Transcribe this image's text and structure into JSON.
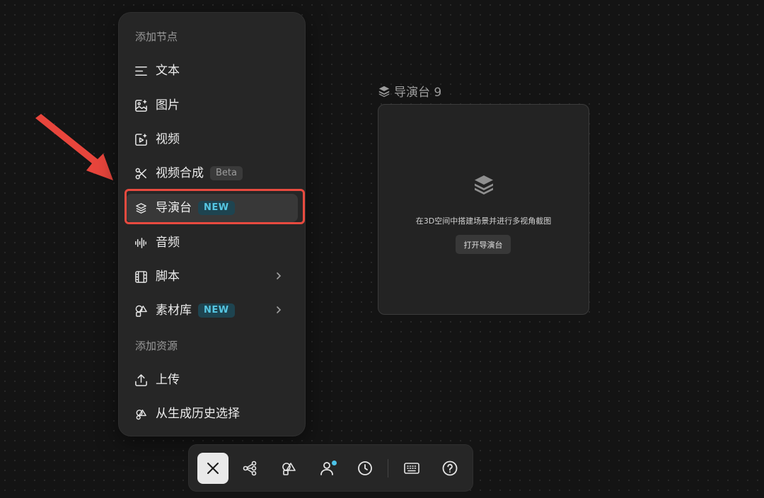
{
  "menu": {
    "add_node_title": "添加节点",
    "items": [
      {
        "label": "文本",
        "icon": "text-lines-icon"
      },
      {
        "label": "图片",
        "icon": "image-sparkle-icon"
      },
      {
        "label": "视频",
        "icon": "video-sparkle-icon"
      },
      {
        "label": "视频合成",
        "icon": "scissors-icon",
        "badge": "Beta"
      },
      {
        "label": "导演台",
        "icon": "layers-icon",
        "badge": "NEW",
        "highlighted": true
      },
      {
        "label": "音频",
        "icon": "audio-wave-icon"
      },
      {
        "label": "脚本",
        "icon": "film-script-icon",
        "has_submenu": true
      },
      {
        "label": "素材库",
        "icon": "shapes-icon",
        "badge": "NEW",
        "has_submenu": true
      }
    ],
    "add_resource_title": "添加资源",
    "resources": [
      {
        "label": "上传",
        "icon": "upload-icon"
      },
      {
        "label": "从生成历史选择",
        "icon": "history-shapes-icon"
      }
    ]
  },
  "node": {
    "title": "导演台 9",
    "description": "在3D空间中搭建场景并进行多视角截图",
    "open_button": "打开导演台"
  },
  "toolbar": {
    "buttons": [
      "close-icon",
      "workflow-icon",
      "assets-icon",
      "person-icon",
      "clock-icon",
      "keyboard-icon",
      "help-icon"
    ]
  },
  "colors": {
    "accent_new": "#56c6e2",
    "highlight": "#e84a3f",
    "notification_dot": "#4cc3e8"
  }
}
